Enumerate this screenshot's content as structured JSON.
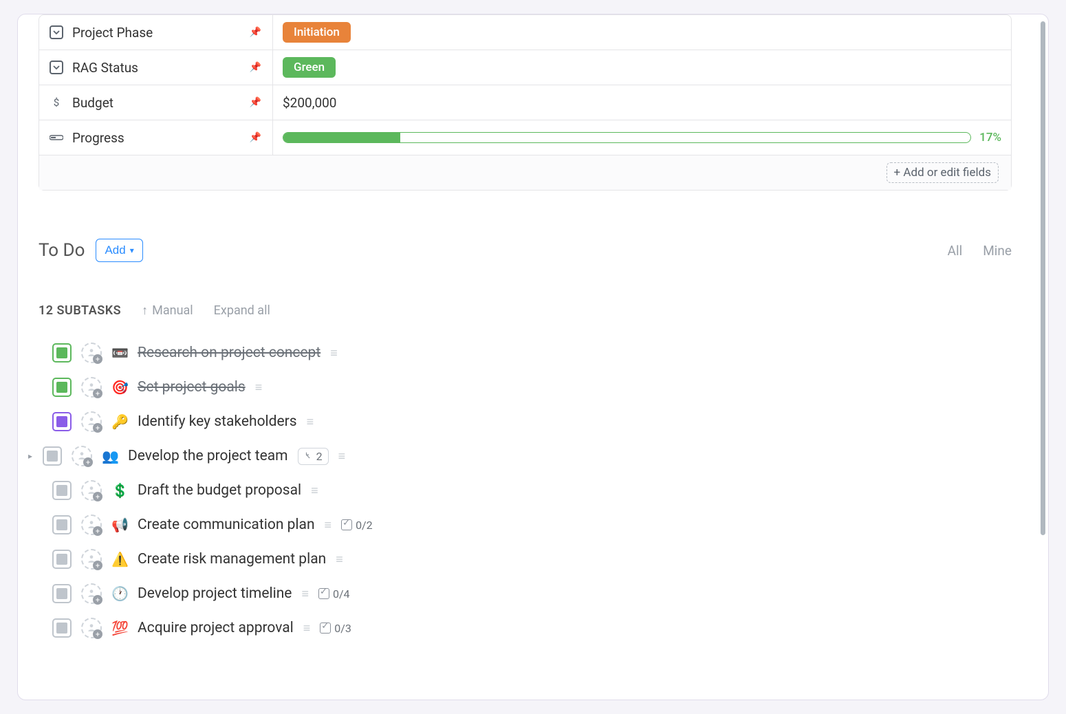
{
  "fields": [
    {
      "icon": "dropdown",
      "label": "Project Phase",
      "pinned": true,
      "type": "badge",
      "value": "Initiation",
      "color": "orange"
    },
    {
      "icon": "dropdown",
      "label": "RAG Status",
      "pinned": true,
      "type": "badge",
      "value": "Green",
      "color": "green"
    },
    {
      "icon": "dollar",
      "label": "Budget",
      "pinned": true,
      "type": "text",
      "value": "$200,000"
    },
    {
      "icon": "progress",
      "label": "Progress",
      "pinned": true,
      "type": "progress",
      "percent": 17,
      "percent_label": "17%"
    }
  ],
  "fields_footer": {
    "add_link": "+ Add or edit fields"
  },
  "todo": {
    "title": "To Do",
    "add_button": "Add",
    "filters": {
      "all": "All",
      "mine": "Mine"
    },
    "subtask_count": "12 SUBTASKS",
    "sort": "Manual",
    "expand": "Expand all"
  },
  "tasks": [
    {
      "status": "done",
      "emoji": "📼",
      "title": "Research on project concept",
      "completed": true
    },
    {
      "status": "done",
      "emoji": "🎯",
      "title": "Set project goals",
      "completed": true
    },
    {
      "status": "purple",
      "emoji": "🔑",
      "title": "Identify key stakeholders"
    },
    {
      "status": "gray",
      "emoji": "👥",
      "title": "Develop the project team",
      "subtasks": "2",
      "expandable": true
    },
    {
      "status": "gray",
      "emoji": "💲",
      "title": "Draft the budget proposal"
    },
    {
      "status": "gray",
      "emoji": "📢",
      "title": "Create communication plan",
      "checklist": "0/2"
    },
    {
      "status": "gray",
      "emoji": "⚠️",
      "title": "Create risk management plan"
    },
    {
      "status": "gray",
      "emoji": "🕐",
      "title": "Develop project timeline",
      "checklist": "0/4"
    },
    {
      "status": "gray",
      "emoji": "💯",
      "title": "Acquire project approval",
      "checklist": "0/3"
    }
  ]
}
